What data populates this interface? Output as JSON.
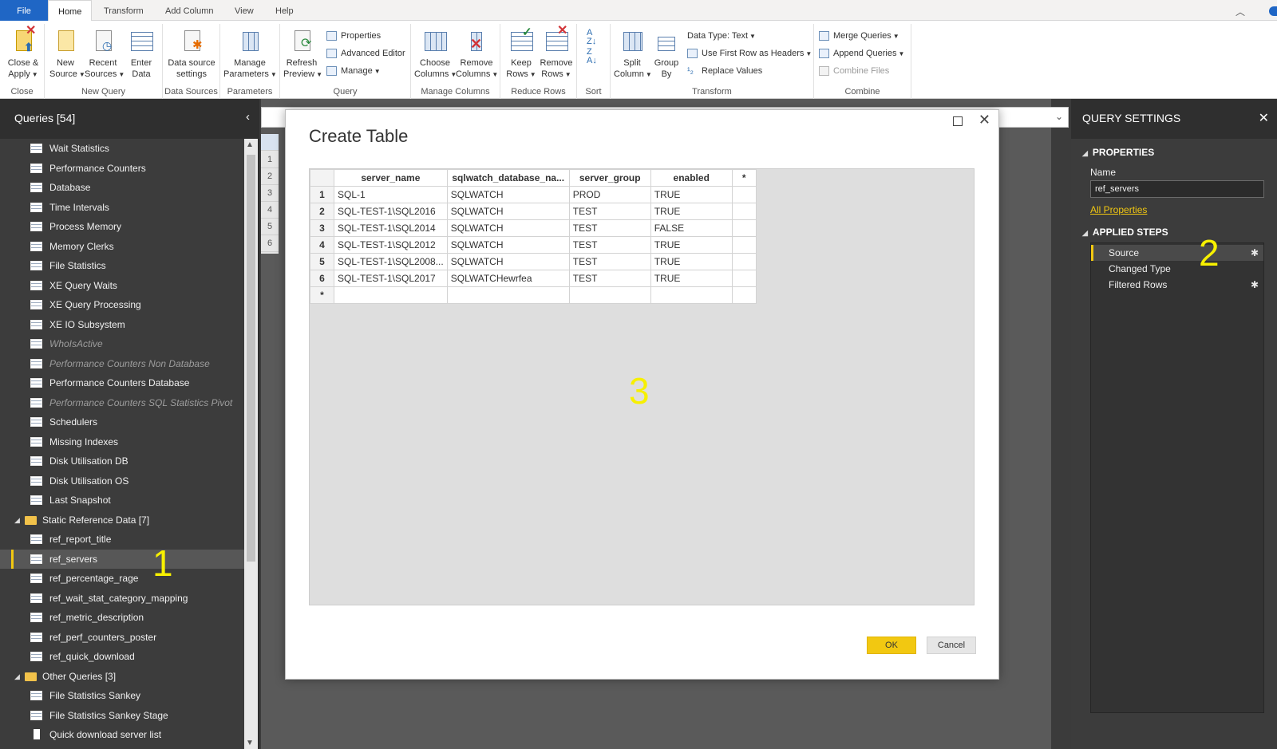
{
  "tabs": [
    {
      "label": "File"
    },
    {
      "label": "Home"
    },
    {
      "label": "Transform"
    },
    {
      "label": "Add Column"
    },
    {
      "label": "View"
    },
    {
      "label": "Help"
    }
  ],
  "ribbon": {
    "close": {
      "close_apply": "Close &",
      "close_apply2": "Apply",
      "group": "Close"
    },
    "new_query": {
      "new_source": "New",
      "new_source2": "Source",
      "recent_sources": "Recent",
      "recent_sources2": "Sources",
      "enter_data": "Enter",
      "enter_data2": "Data",
      "group": "New Query"
    },
    "data_sources": {
      "settings": "Data source",
      "settings2": "settings",
      "group": "Data Sources"
    },
    "parameters": {
      "manage": "Manage",
      "manage2": "Parameters",
      "group": "Parameters"
    },
    "query": {
      "refresh": "Refresh",
      "refresh2": "Preview",
      "properties": "Properties",
      "advanced_editor": "Advanced Editor",
      "manage": "Manage",
      "group": "Query"
    },
    "manage_columns": {
      "choose": "Choose",
      "choose2": "Columns",
      "remove": "Remove",
      "remove2": "Columns",
      "group": "Manage Columns"
    },
    "reduce_rows": {
      "keep": "Keep",
      "keep2": "Rows",
      "remove": "Remove",
      "remove2": "Rows",
      "group": "Reduce Rows"
    },
    "sort": {
      "group": "Sort"
    },
    "transform": {
      "split": "Split",
      "split2": "Column",
      "group_by": "Group",
      "group_by2": "By",
      "data_type": "Data Type: Text",
      "first_row": "Use First Row as Headers",
      "replace": "Replace Values",
      "group": "Transform"
    },
    "combine": {
      "merge": "Merge Queries",
      "append": "Append Queries",
      "combine_files": "Combine Files",
      "group": "Combine"
    }
  },
  "queries_panel": {
    "title": "Queries [54]",
    "items": [
      {
        "label": "Wait Statistics",
        "type": "table",
        "disabled": false
      },
      {
        "label": "Performance Counters",
        "type": "table",
        "disabled": false
      },
      {
        "label": "Database",
        "type": "table",
        "disabled": false
      },
      {
        "label": "Time Intervals",
        "type": "table",
        "disabled": false
      },
      {
        "label": "Process Memory",
        "type": "table",
        "disabled": false
      },
      {
        "label": "Memory Clerks",
        "type": "table",
        "disabled": false
      },
      {
        "label": "File Statistics",
        "type": "table",
        "disabled": false
      },
      {
        "label": "XE Query Waits",
        "type": "table",
        "disabled": false
      },
      {
        "label": "XE Query Processing",
        "type": "table",
        "disabled": false
      },
      {
        "label": "XE IO Subsystem",
        "type": "table",
        "disabled": false
      },
      {
        "label": "WhoIsActive",
        "type": "table",
        "disabled": true
      },
      {
        "label": "Performance Counters Non Database",
        "type": "table",
        "disabled": true
      },
      {
        "label": "Performance Counters Database",
        "type": "table",
        "disabled": false
      },
      {
        "label": "Performance Counters SQL Statistics Pivot",
        "type": "table",
        "disabled": true
      },
      {
        "label": "Schedulers",
        "type": "table",
        "disabled": false
      },
      {
        "label": "Missing Indexes",
        "type": "table",
        "disabled": false
      },
      {
        "label": "Disk Utilisation DB",
        "type": "table",
        "disabled": false
      },
      {
        "label": "Disk Utilisation OS",
        "type": "table",
        "disabled": false
      },
      {
        "label": "Last Snapshot",
        "type": "table",
        "disabled": false
      },
      {
        "label": "Static Reference Data [7]",
        "type": "folder"
      },
      {
        "label": "ref_report_title",
        "type": "table",
        "disabled": false
      },
      {
        "label": "ref_servers",
        "type": "table",
        "disabled": false,
        "selected": true
      },
      {
        "label": "ref_percentage_rage",
        "type": "table",
        "disabled": false
      },
      {
        "label": "ref_wait_stat_category_mapping",
        "type": "table",
        "disabled": false
      },
      {
        "label": "ref_metric_description",
        "type": "table",
        "disabled": false
      },
      {
        "label": "ref_perf_counters_poster",
        "type": "table",
        "disabled": false
      },
      {
        "label": "ref_quick_download",
        "type": "table",
        "disabled": false
      },
      {
        "label": "Other Queries [3]",
        "type": "folder"
      },
      {
        "label": "File Statistics Sankey",
        "type": "table",
        "disabled": false
      },
      {
        "label": "File Statistics Sankey Stage",
        "type": "table",
        "disabled": false
      },
      {
        "label": "Quick download server list",
        "type": "page",
        "disabled": false
      }
    ]
  },
  "background_grid": {
    "row_numbers": [
      "1",
      "2",
      "3",
      "4",
      "5",
      "6"
    ]
  },
  "settings": {
    "title": "QUERY SETTINGS",
    "properties_label": "PROPERTIES",
    "name_label": "Name",
    "name_value": "ref_servers",
    "all_properties": "All Properties",
    "applied_steps_label": "APPLIED STEPS",
    "steps": [
      {
        "label": "Source",
        "gear": true,
        "selected": true
      },
      {
        "label": "Changed Type",
        "gear": false,
        "selected": false
      },
      {
        "label": "Filtered Rows",
        "gear": true,
        "selected": false
      }
    ]
  },
  "dialog": {
    "title": "Create Table",
    "columns": [
      "server_name",
      "sqlwatch_database_na...",
      "server_group",
      "enabled",
      "*"
    ],
    "rows": [
      {
        "n": "1",
        "cells": [
          "SQL-1",
          "SQLWATCH",
          "PROD",
          "TRUE"
        ]
      },
      {
        "n": "2",
        "cells": [
          "SQL-TEST-1\\SQL2016",
          "SQLWATCH",
          "TEST",
          "TRUE"
        ]
      },
      {
        "n": "3",
        "cells": [
          "SQL-TEST-1\\SQL2014",
          "SQLWATCH",
          "TEST",
          "FALSE"
        ]
      },
      {
        "n": "4",
        "cells": [
          "SQL-TEST-1\\SQL2012",
          "SQLWATCH",
          "TEST",
          "TRUE"
        ]
      },
      {
        "n": "5",
        "cells": [
          "SQL-TEST-1\\SQL2008...",
          "SQLWATCH",
          "TEST",
          "TRUE"
        ]
      },
      {
        "n": "6",
        "cells": [
          "SQL-TEST-1\\SQL2017",
          "SQLWATCHewrfea",
          "TEST",
          "TRUE"
        ]
      }
    ],
    "new_row_marker": "*",
    "ok_label": "OK",
    "cancel_label": "Cancel"
  },
  "annotations": {
    "one": "1",
    "two": "2",
    "three": "3"
  },
  "colors": {
    "accent": "#f2c811",
    "file_tab": "#1f66c5",
    "annotation": "#f7f000"
  }
}
